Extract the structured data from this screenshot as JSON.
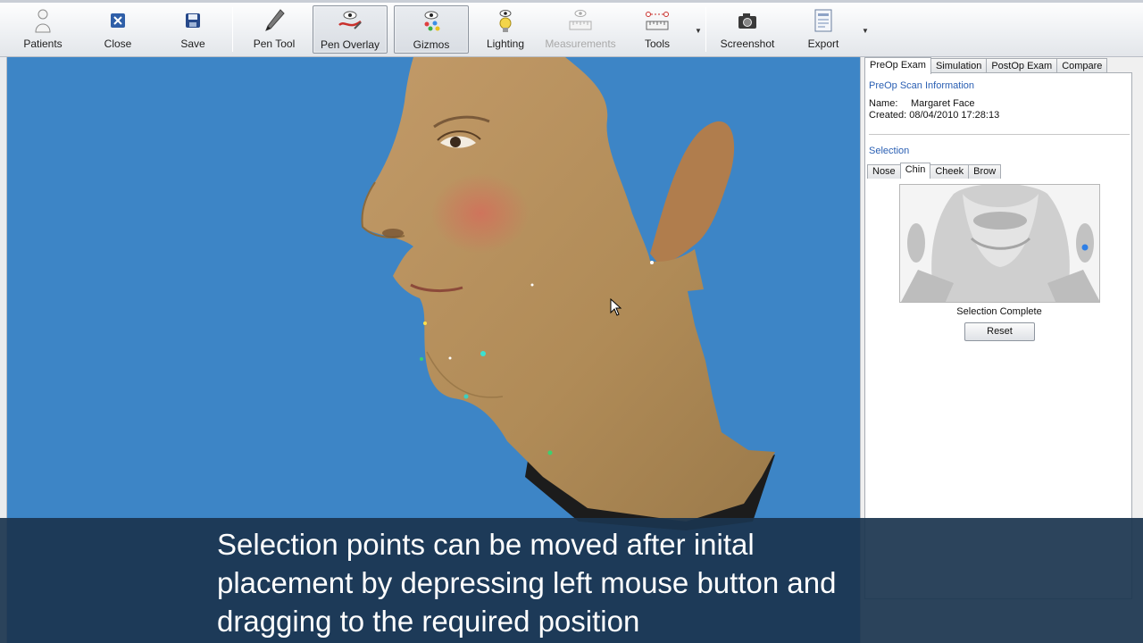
{
  "toolbar": {
    "buttons": [
      {
        "id": "patients",
        "label": "Patients",
        "icon": "person-icon"
      },
      {
        "id": "close",
        "label": "Close",
        "icon": "close-x-icon"
      },
      {
        "id": "save",
        "label": "Save",
        "icon": "floppy-disk-icon"
      },
      {
        "id": "pen-tool",
        "label": "Pen Tool",
        "icon": "pen-icon"
      },
      {
        "id": "pen-overlay",
        "label": "Pen Overlay",
        "icon": "pen-overlay-eye-icon",
        "active": true
      },
      {
        "id": "gizmos",
        "label": "Gizmos",
        "icon": "gizmos-eye-icon",
        "active": true
      },
      {
        "id": "lighting",
        "label": "Lighting",
        "icon": "lightbulb-eye-icon"
      },
      {
        "id": "measurements",
        "label": "Measurements",
        "icon": "ruler-eye-icon",
        "disabled": true
      },
      {
        "id": "tools",
        "label": "Tools",
        "icon": "tools-ruler-icon"
      },
      {
        "id": "screenshot",
        "label": "Screenshot",
        "icon": "camera-icon"
      },
      {
        "id": "export",
        "label": "Export",
        "icon": "document-icon"
      }
    ]
  },
  "panel": {
    "tabs": [
      "PreOp Exam",
      "Simulation",
      "PostOp Exam",
      "Compare"
    ],
    "active_tab": "PreOp Exam",
    "scan_info_title": "PreOp Scan Information",
    "name_key": "Name:",
    "name_value": "Margaret Face",
    "created_key": "Created:",
    "created_value": "08/04/2010 17:28:13",
    "selection_title": "Selection",
    "subtabs": [
      "Nose",
      "Chin",
      "Cheek",
      "Brow"
    ],
    "active_subtab": "Chin",
    "selection_status": "Selection Complete",
    "reset_label": "Reset"
  },
  "viewport": {
    "background_color": "#3d85c6",
    "skin_color": "#b8925e"
  },
  "caption": {
    "line1": "Selection points can be moved after inital",
    "line2": "placement by depressing left mouse button and",
    "line3": "dragging to the required position"
  }
}
